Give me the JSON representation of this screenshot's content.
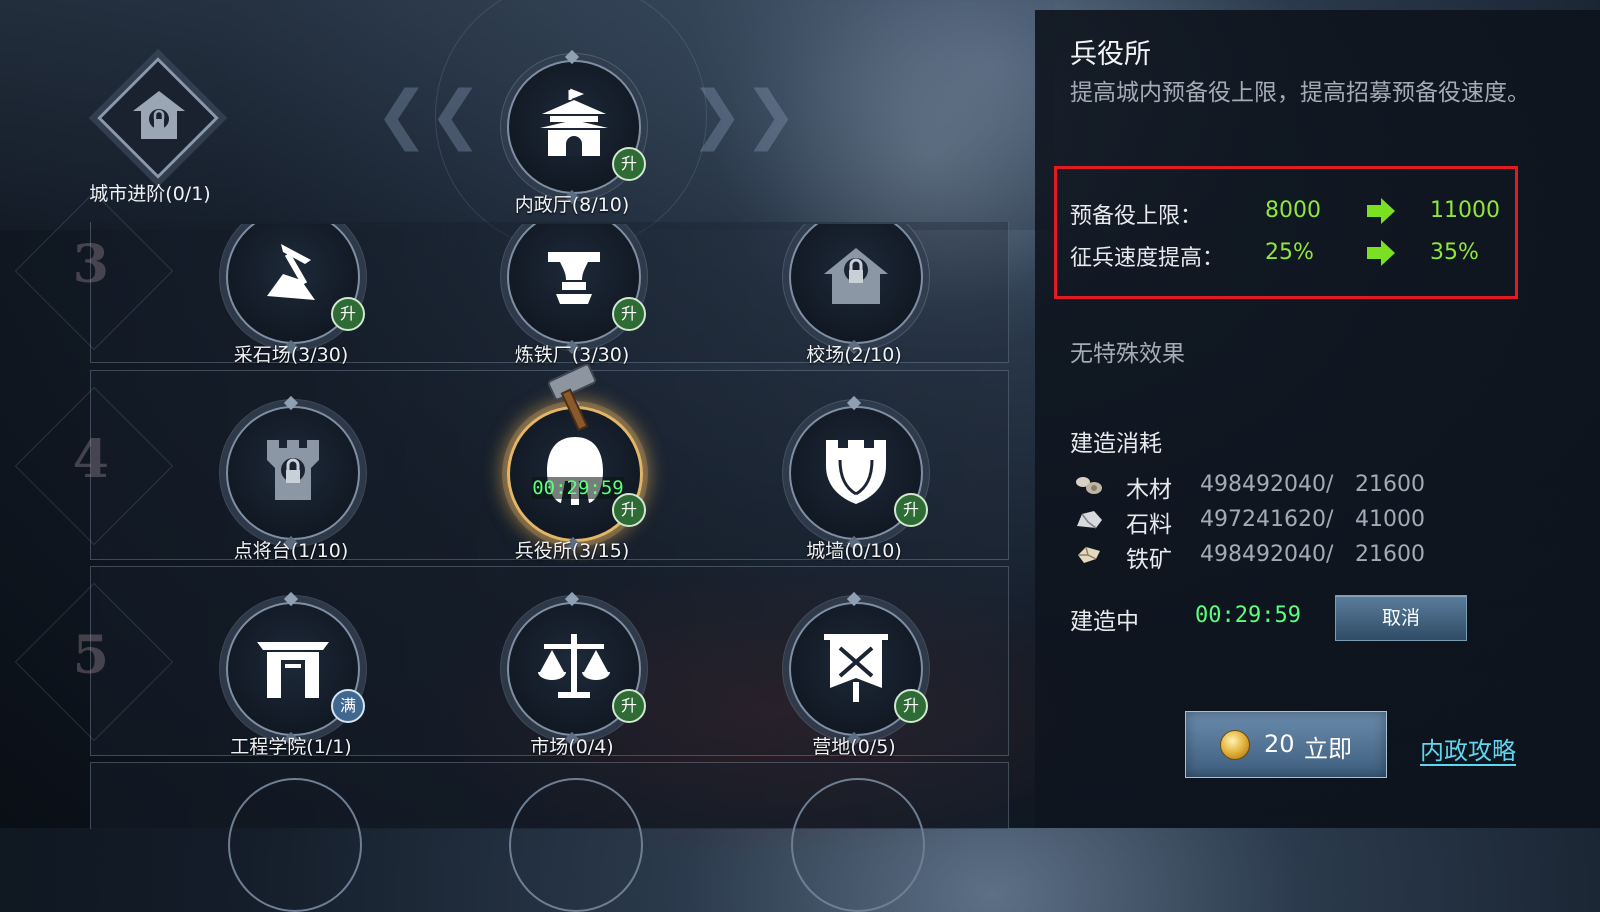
{
  "top_row": {
    "city_advance_label": "城市进阶(0/1)",
    "interior_hall_label": "内政厅(8/10)",
    "interior_hall_badge": "升"
  },
  "rows": [
    {
      "number": "3",
      "buildings": [
        {
          "label": "采石场(3/30)",
          "badge": "升",
          "icon": "pickaxe-rock-icon"
        },
        {
          "label": "炼铁厂(3/30)",
          "badge": "升",
          "icon": "anvil-icon"
        },
        {
          "label": "校场(2/10)",
          "badge": "",
          "icon": "locked-house-icon"
        }
      ]
    },
    {
      "number": "4",
      "buildings": [
        {
          "label": "点将台(1/10)",
          "badge": "",
          "icon": "locked-tower-icon"
        },
        {
          "label": "兵役所(3/15)",
          "badge": "升",
          "icon": "spartan-helmet-icon",
          "timer": "00:29:59"
        },
        {
          "label": "城墙(0/10)",
          "badge": "升",
          "icon": "wall-shield-icon"
        }
      ]
    },
    {
      "number": "5",
      "buildings": [
        {
          "label": "工程学院(1/1)",
          "badge": "满",
          "icon": "gate-icon"
        },
        {
          "label": "市场(0/4)",
          "badge": "升",
          "icon": "scales-icon"
        },
        {
          "label": "营地(0/5)",
          "badge": "升",
          "icon": "banner-swords-icon"
        }
      ]
    }
  ],
  "detail": {
    "title": "兵役所",
    "description": "提高城内预备役上限，提高招募预备役速度。",
    "stats": [
      {
        "label": "预备役上限：",
        "current": "8000",
        "next": "11000"
      },
      {
        "label": "征兵速度提高：",
        "current": "25%",
        "next": "35%"
      }
    ],
    "special_effect": "无特殊效果",
    "cost_title": "建造消耗",
    "costs": [
      {
        "name": "木材",
        "have": "498492040",
        "need": "21600",
        "icon": "wood-icon"
      },
      {
        "name": "石料",
        "have": "497241620",
        "need": "41000",
        "icon": "stone-icon"
      },
      {
        "name": "铁矿",
        "have": "498492040",
        "need": "21600",
        "icon": "iron-ore-icon"
      }
    ],
    "separator": "/",
    "building_status": "建造中",
    "building_timer": "00:29:59",
    "cancel_label": "取消",
    "instant_cost": "20",
    "instant_label": "立即",
    "guide_link": "内政攻略"
  },
  "colors": {
    "accent_green": "#8fe63c",
    "timer_green": "#59ff7d",
    "highlight_red": "#e11b22",
    "link_cyan": "#5fd6ef"
  }
}
